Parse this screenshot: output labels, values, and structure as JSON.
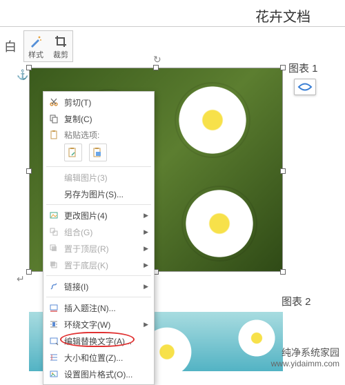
{
  "header": {
    "doc_title": "花卉文档"
  },
  "ribbon": {
    "white": "白",
    "style": "样式",
    "crop": "裁剪"
  },
  "captions": {
    "c1": "图表 1",
    "c2": "图表 2"
  },
  "context_menu": {
    "cut": {
      "label": "剪切(T)"
    },
    "copy": {
      "label": "复制(C)"
    },
    "paste_hdr": {
      "label": "粘贴选项:"
    },
    "edit_pic": {
      "label": "编辑图片(3)"
    },
    "save_as": {
      "label": "另存为图片(S)..."
    },
    "change_pic": {
      "label": "更改图片(4)"
    },
    "group": {
      "label": "组合(G)"
    },
    "bring_front": {
      "label": "置于顶层(R)"
    },
    "send_back": {
      "label": "置于底层(K)"
    },
    "link": {
      "label": "链接(I)"
    },
    "insert_cap": {
      "label": "插入题注(N)..."
    },
    "wrap_text": {
      "label": "环绕文字(W)"
    },
    "edit_alt": {
      "label": "编辑替换文字(A)..."
    },
    "size_pos": {
      "label": "大小和位置(Z)..."
    },
    "format_pic": {
      "label": "设置图片格式(O)..."
    }
  },
  "watermark": {
    "line1": "纯净系统家园",
    "line2": "www.yidaimm.com"
  }
}
